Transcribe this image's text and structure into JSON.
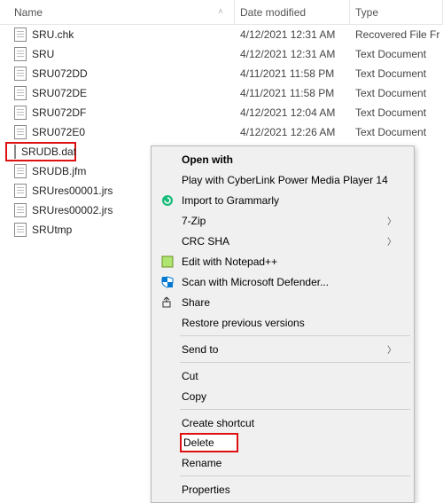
{
  "columns": {
    "name": "Name",
    "date": "Date modified",
    "type": "Type"
  },
  "sort_indicator": "▲",
  "files": [
    {
      "name": "SRU.chk",
      "date": "4/12/2021 12:31 AM",
      "type": "Recovered File Fr"
    },
    {
      "name": "SRU",
      "date": "4/12/2021 12:31 AM",
      "type": "Text Document"
    },
    {
      "name": "SRU072DD",
      "date": "4/11/2021 11:58 PM",
      "type": "Text Document"
    },
    {
      "name": "SRU072DE",
      "date": "4/11/2021 11:58 PM",
      "type": "Text Document"
    },
    {
      "name": "SRU072DF",
      "date": "4/12/2021 12:04 AM",
      "type": "Text Document"
    },
    {
      "name": "SRU072E0",
      "date": "4/12/2021 12:26 AM",
      "type": "Text Document"
    }
  ],
  "selected_file": {
    "name": "SRUDB.dat"
  },
  "hidden_files": [
    {
      "name": "SRUDB.jfm"
    },
    {
      "name": "SRUres00001.jrs"
    },
    {
      "name": "SRUres00002.jrs"
    },
    {
      "name": "SRUtmp"
    }
  ],
  "menu": {
    "open_with": "Open with",
    "cyberlink": "Play with CyberLink Power Media Player 14",
    "grammarly": "Import to Grammarly",
    "sevenzip": "7-Zip",
    "crcsha": "CRC SHA",
    "notepadpp": "Edit with Notepad++",
    "defender": "Scan with Microsoft Defender...",
    "share": "Share",
    "restore": "Restore previous versions",
    "sendto": "Send to",
    "cut": "Cut",
    "copy": "Copy",
    "shortcut": "Create shortcut",
    "delete": "Delete",
    "rename": "Rename",
    "properties": "Properties"
  }
}
